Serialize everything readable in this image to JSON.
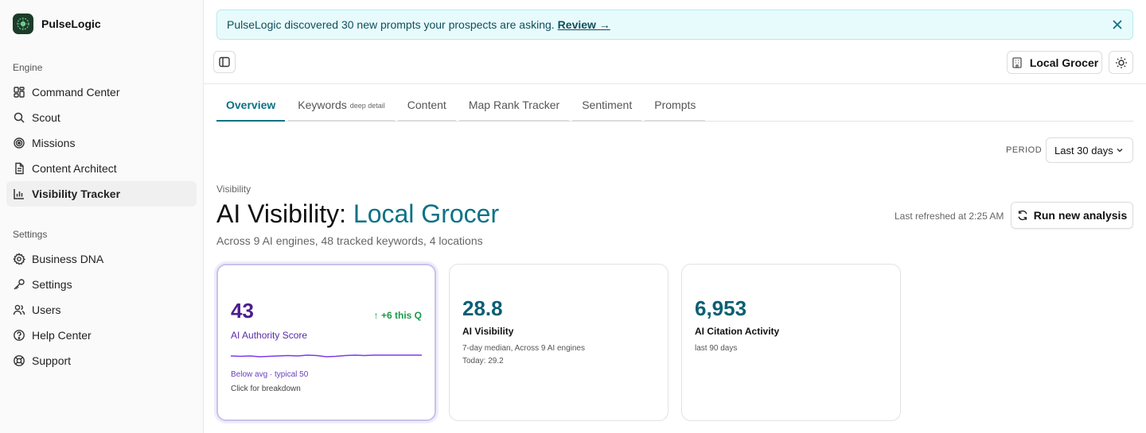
{
  "app": {
    "name": "PulseLogic"
  },
  "sidebar": {
    "engine_label": "Engine",
    "settings_label": "Settings",
    "engine_items": [
      {
        "label": "Command Center",
        "icon": "dashboard-icon"
      },
      {
        "label": "Scout",
        "icon": "search-icon"
      },
      {
        "label": "Missions",
        "icon": "target-icon"
      },
      {
        "label": "Content Architect",
        "icon": "document-icon"
      },
      {
        "label": "Visibility Tracker",
        "icon": "bar-chart-icon",
        "active": true
      }
    ],
    "settings_items": [
      {
        "label": "Business DNA",
        "icon": "gear-icon"
      },
      {
        "label": "Settings",
        "icon": "key-icon"
      },
      {
        "label": "Users",
        "icon": "users-icon"
      },
      {
        "label": "Help Center",
        "icon": "help-icon"
      },
      {
        "label": "Support",
        "icon": "lifebuoy-icon"
      }
    ]
  },
  "banner": {
    "text": "PulseLogic discovered 30 new prompts your prospects are asking.",
    "link": "Review →"
  },
  "header": {
    "account": "Local Grocer"
  },
  "tabs": [
    {
      "label": "Overview",
      "active": true
    },
    {
      "label": "Keywords",
      "suffix": "deep detail"
    },
    {
      "label": "Content"
    },
    {
      "label": "Map Rank Tracker"
    },
    {
      "label": "Sentiment"
    },
    {
      "label": "Prompts"
    }
  ],
  "period": {
    "label": "PERIOD",
    "value": "Last 30 days"
  },
  "page": {
    "crumb": "Visibility",
    "title_prefix": "AI Visibility:",
    "title_accent": "Local Grocer",
    "subtitle": "Across 9 AI engines, 48 tracked keywords, 4 locations",
    "refreshed": "Last refreshed at 2:25 AM",
    "run_button": "Run new analysis"
  },
  "cards": [
    {
      "value": "43",
      "label": "AI Authority Score",
      "trend": "↑ +6 this Q",
      "note": "Below avg · typical 50",
      "action": "Click for breakdown"
    },
    {
      "value": "28.8",
      "label": "AI Visibility",
      "note1": "7-day median, Across 9 AI engines",
      "note2": "Today: 29.2"
    },
    {
      "value": "6,953",
      "label": "AI Citation Activity",
      "note1": "last 90 days"
    }
  ],
  "colors": {
    "accent": "#0b7285",
    "authority": "#4b1d8f",
    "positive": "#1a9a4a",
    "banner_bg": "#e8fbfc"
  }
}
